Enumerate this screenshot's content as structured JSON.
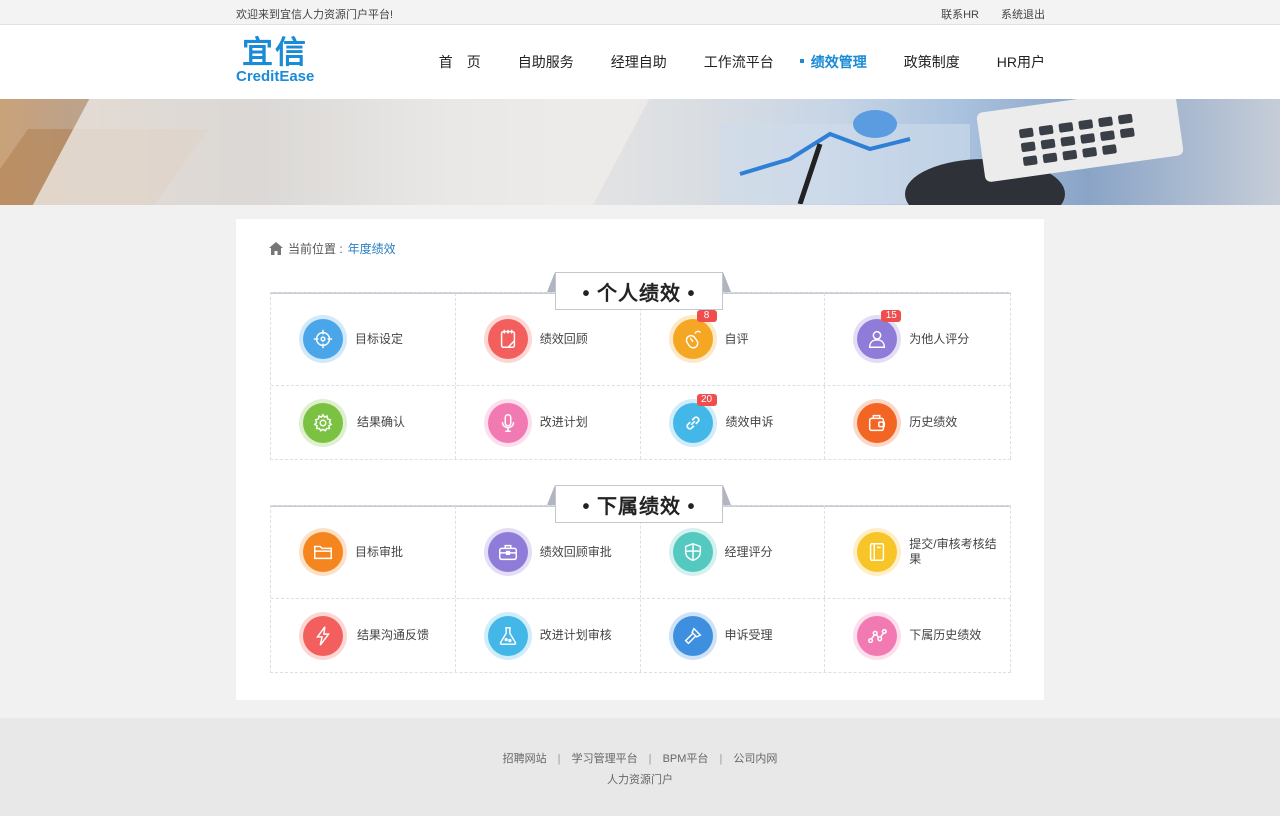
{
  "topbar": {
    "welcome": "欢迎来到宜信人力资源门户平台!",
    "contact": "联系HR",
    "logout": "系统退出"
  },
  "logo": {
    "cn": "宜信",
    "en": "CreditEase"
  },
  "nav": {
    "items": [
      {
        "label": "首　页"
      },
      {
        "label": "自助服务"
      },
      {
        "label": "经理自助"
      },
      {
        "label": "工作流平台"
      },
      {
        "label": "绩效管理",
        "active": true
      },
      {
        "label": "政策制度"
      },
      {
        "label": "HR用户"
      }
    ]
  },
  "breadcrumb": {
    "prefix": "当前位置 :",
    "current": "年度绩效"
  },
  "personal": {
    "title": "• 个人绩效 •",
    "items": [
      {
        "label": "目标设定",
        "icon": "target-icon",
        "color": "#4aa6e8"
      },
      {
        "label": "绩效回顾",
        "icon": "notepad-icon",
        "color": "#f25f5c"
      },
      {
        "label": "自评",
        "icon": "mouse-icon",
        "color": "#f5a623",
        "badge": "8"
      },
      {
        "label": "为他人评分",
        "icon": "user-icon",
        "color": "#8e7cd8",
        "badge": "15"
      },
      {
        "label": "结果确认",
        "icon": "gear-icon",
        "color": "#7cc242"
      },
      {
        "label": "改进计划",
        "icon": "microphone-icon",
        "color": "#f27ab3"
      },
      {
        "label": "绩效申诉",
        "icon": "link-icon",
        "color": "#43b7e8",
        "badge": "20"
      },
      {
        "label": "历史绩效",
        "icon": "wallet-icon",
        "color": "#f26522"
      }
    ]
  },
  "subordinate": {
    "title": "• 下属绩效 •",
    "items": [
      {
        "label": "目标审批",
        "icon": "folder-icon",
        "color": "#f5861f"
      },
      {
        "label": "绩效回顾审批",
        "icon": "briefcase-icon",
        "color": "#8e7cd8"
      },
      {
        "label": "经理评分",
        "icon": "shield-icon",
        "color": "#54c9c0"
      },
      {
        "label": "提交/审核考核结果",
        "icon": "book-icon",
        "color": "#f7c528"
      },
      {
        "label": "结果沟通反馈",
        "icon": "lightning-icon",
        "color": "#f25f5c"
      },
      {
        "label": "改进计划审核",
        "icon": "flask-icon",
        "color": "#43b7e8"
      },
      {
        "label": "申诉受理",
        "icon": "flashlight-icon",
        "color": "#3f8fe0"
      },
      {
        "label": "下属历史绩效",
        "icon": "nodes-icon",
        "color": "#f27ab3"
      }
    ]
  },
  "footer": {
    "links": [
      "招聘网站",
      "学习管理平台",
      "BPM平台",
      "公司内网"
    ],
    "separator": "|",
    "sub": "人力资源门户"
  }
}
